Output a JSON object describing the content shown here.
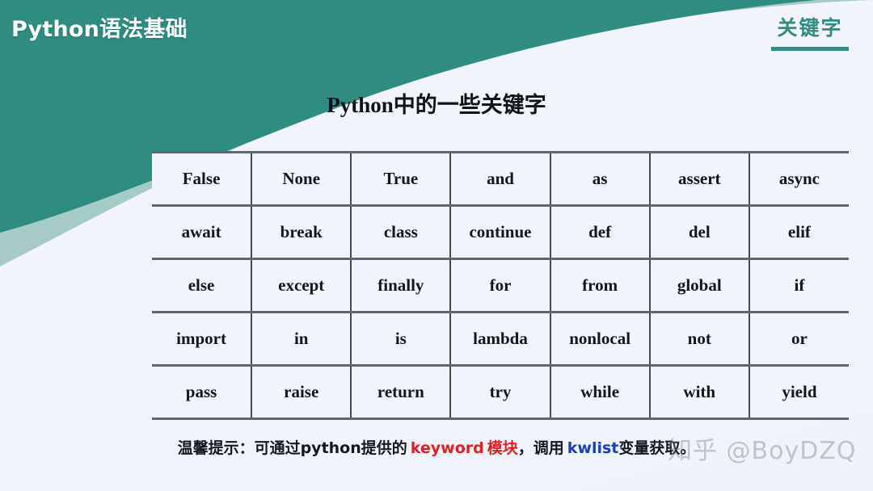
{
  "deck": {
    "title": "Python语法基础",
    "section_label": "关键字",
    "accent_color": "#2e8c81",
    "band_color_dark": "#2e8c81",
    "band_color_light": "#a8cdc7",
    "page_background": "#eef2fa"
  },
  "heading": "Python中的一些关键字",
  "table": {
    "columns": 7,
    "rows": [
      [
        "False",
        "None",
        "True",
        "and",
        "as",
        "assert",
        "async"
      ],
      [
        "await",
        "break",
        "class",
        "continue",
        "def",
        "del",
        "elif"
      ],
      [
        "else",
        "except",
        "finally",
        "for",
        "from",
        "global",
        "if"
      ],
      [
        "import",
        "in",
        "is",
        "lambda",
        "nonlocal",
        "not",
        "or"
      ],
      [
        "pass",
        "raise",
        "return",
        "try",
        "while",
        "with",
        "yield"
      ]
    ],
    "cell_background": "#f0f4fb",
    "border_color": "#5d6576"
  },
  "footer": {
    "part1": "温馨提示：可通过python提供的",
    "highlight1": "keyword",
    "highlight1_color": "#e02020",
    "part2": "模块",
    "part3": "，调用",
    "highlight2": "kwlist",
    "highlight2_color": "#1d3fb5",
    "part4": "变量获取。"
  },
  "watermark": "知乎 @BoyDZQ"
}
